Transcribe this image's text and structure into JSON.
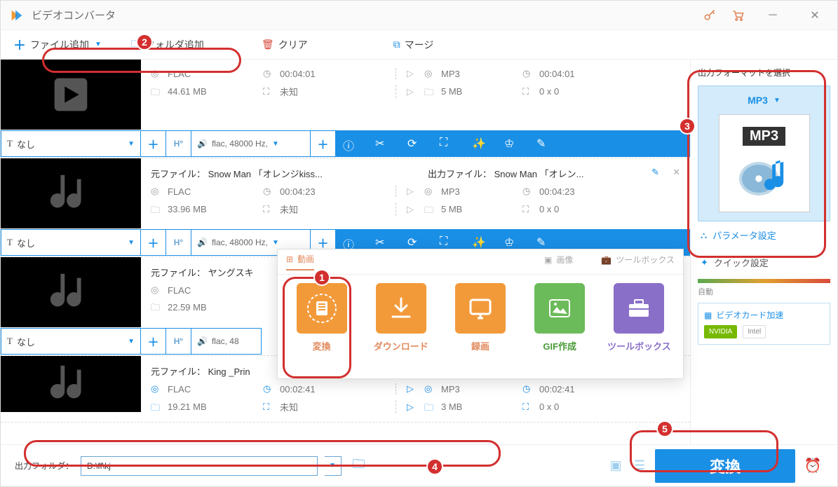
{
  "window": {
    "title": "ビデオコンバータ"
  },
  "toolbar": {
    "add_file": "ファイル追加",
    "add_folder": "フォルダ追加",
    "clear": "クリア",
    "merge": "マージ"
  },
  "subtitle_none": "なし",
  "items": [
    {
      "src_title": "",
      "src_codec": "FLAC",
      "src_dur": "00:04:01",
      "src_size": "44.61 MB",
      "src_res": "未知",
      "out_codec": "MP3",
      "out_dur": "00:04:01",
      "out_size": "5 MB",
      "out_res": "0 x 0",
      "audio": "flac, 48000 Hz, "
    },
    {
      "src_title": "元ファイル： Snow Man 「オレンジkiss...",
      "out_title": "出力ファイル： Snow Man 「オレン...",
      "src_codec": "FLAC",
      "src_dur": "00:04:23",
      "src_size": "33.96 MB",
      "src_res": "未知",
      "out_codec": "MP3",
      "out_dur": "00:04:23",
      "out_size": "5 MB",
      "out_res": "0 x 0",
      "audio": "flac, 48000 Hz, "
    },
    {
      "src_title": "元ファイル： ヤングスキ",
      "src_codec": "FLAC",
      "src_size": "22.59 MB",
      "audio": "flac, 48"
    },
    {
      "src_title": "元ファイル： King _Prin",
      "src_codec": "FLAC",
      "src_dur": "00:02:41",
      "src_size": "19.21 MB",
      "src_res": "未知",
      "out_codec": "MP3",
      "out_dur": "00:02:41",
      "out_size": "3 MB",
      "out_res": "0 x 0"
    }
  ],
  "side": {
    "title": "出力フォーマットを選択",
    "format": "MP3",
    "format_label": "MP3",
    "param": "パラメータ設定",
    "quick": "クイック設定",
    "slider_label": "自動",
    "gpu_title": "ビデオカード加速",
    "gpu_nvidia": "NVIDIA",
    "gpu_intel": "Intel"
  },
  "popup": {
    "tab_video": "動画",
    "tab_image": "画像",
    "tab_tool": "ツールボックス",
    "convert": "変換",
    "download": "ダウンロード",
    "record": "録画",
    "gif": "GIF作成",
    "toolbox": "ツールボックス"
  },
  "footer": {
    "out_label": "出力フォルダ：",
    "out_path": "D:\\ff\\kj",
    "convert": "変換"
  },
  "annotations": [
    "1",
    "2",
    "3",
    "4",
    "5"
  ]
}
